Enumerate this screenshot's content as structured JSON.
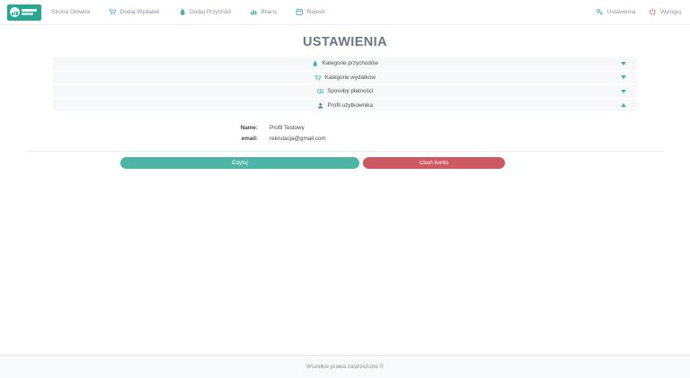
{
  "navbar": {
    "logo": {
      "name": "budget-app-logo"
    },
    "items": [
      {
        "label": "Strona Główna",
        "icon": "none"
      },
      {
        "label": "Dodaj Wydatek",
        "icon": "cart-icon"
      },
      {
        "label": "Dodaj Przychód",
        "icon": "drop-icon"
      },
      {
        "label": "Bilans",
        "icon": "bar-chart-icon"
      },
      {
        "label": "Rejestr",
        "icon": "calendar-icon"
      }
    ],
    "right_items": [
      {
        "label": "Ustawienia",
        "icon": "gears-icon",
        "icon_color": "#45b5a2"
      },
      {
        "label": "Wyloguj",
        "icon": "power-icon",
        "icon_color": "#cd5a62"
      }
    ]
  },
  "page": {
    "title": "USTAWIENIA"
  },
  "accordion": [
    {
      "label": "Kategorie przychodów",
      "icon": "drop-icon",
      "expanded": false
    },
    {
      "label": "Kategorie wydatków",
      "icon": "cart-icon",
      "expanded": false
    },
    {
      "label": "Sposoby płatności",
      "icon": "banknote-icon",
      "expanded": false
    },
    {
      "label": "Profil użytkownika",
      "icon": "user-icon",
      "expanded": true
    }
  ],
  "profile": {
    "fields": [
      {
        "label": "Name:",
        "value": "Profil Testowy"
      },
      {
        "label": "email:",
        "value": "rekrutacja@gmail.com"
      }
    ],
    "buttons": [
      {
        "label": "Edytuj",
        "color": "#4cb5a3"
      },
      {
        "label": "Usuń konto",
        "color": "#cd5a62"
      }
    ]
  },
  "footer": {
    "text": "Wszelkie prawa zastrzeżone ©"
  },
  "colors": {
    "teal": "#45b5a2",
    "teal_dark": "#27a690",
    "red": "#cd5a62",
    "row_bg": "#f7f8f9",
    "muted_text": "#8b9299",
    "title_text": "#6e7781"
  }
}
